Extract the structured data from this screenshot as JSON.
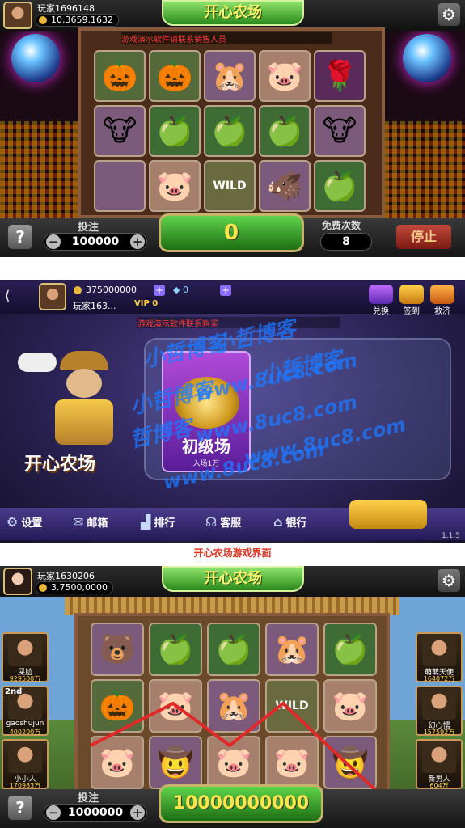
{
  "screen1": {
    "player_name": "玩家1696148",
    "balance": "10.3659.1632",
    "title": "开心农场",
    "marquee": "游戏演示软件请联系销售人员",
    "reels": [
      [
        "🎃",
        "🎃",
        "🐹",
        "🐷",
        "🌹"
      ],
      [
        "🐮",
        "🍏",
        "🍏",
        "🍏",
        "🐮"
      ],
      [
        "",
        "🐷",
        "WILD",
        "🐗",
        "🍏"
      ]
    ],
    "bet_label": "投注",
    "bet_value": "100000",
    "win_value": "0",
    "free_label": "免费次数",
    "free_count": "8",
    "stop_label": "停止"
  },
  "screen2": {
    "player_name": "玩家163...",
    "gold": "375000000",
    "diamond": "0",
    "vip": "VIP 0",
    "marquee": "游戏演示软件联系购买",
    "right_buttons": [
      "兑换",
      "签到",
      "救济"
    ],
    "game_logo": "开心农场",
    "room_name": "初级场",
    "room_entry": "入场1万",
    "menu": [
      {
        "icon": "⚙",
        "label": "设置"
      },
      {
        "icon": "✉",
        "label": "邮箱"
      },
      {
        "icon": "▟",
        "label": "排行"
      },
      {
        "icon": "☊",
        "label": "客服"
      },
      {
        "icon": "⌂",
        "label": "银行"
      }
    ],
    "version": "1.1.5",
    "watermarks": [
      "小哲博客",
      "小哲博客",
      "小哲博客",
      "小哲博客",
      "www.8uc8.com",
      "哲博客",
      "www.8uc8.com",
      "www.8uc8.com",
      "www.8uc8.com"
    ]
  },
  "caption": "开心农场游戏界面",
  "screen3": {
    "player_name": "玩家1630206",
    "balance": "3.7500,0000",
    "title": "开心农场",
    "left_players": [
      {
        "rank": "",
        "name": "屎尬",
        "value": "929500万"
      },
      {
        "rank": "2nd",
        "name": "gaoshujun",
        "value": "400200万"
      },
      {
        "rank": "",
        "name": "小小人",
        "value": "170983万"
      }
    ],
    "right_players": [
      {
        "name": "萌萌天使",
        "value": "164072万"
      },
      {
        "name": "幻心懦",
        "value": "157592万"
      },
      {
        "name": "新男人",
        "value": "604万"
      }
    ],
    "reels": [
      [
        "🐻",
        "🍏",
        "🍏",
        "🐹",
        "🍏"
      ],
      [
        "🎃",
        "🐷",
        "🐹",
        "WILD",
        "🐷"
      ],
      [
        "🐷",
        "🤠",
        "🐷",
        "🐷",
        "🤠"
      ]
    ],
    "bet_label": "投注",
    "bet_value": "1000000",
    "win_value": "10000000000"
  }
}
